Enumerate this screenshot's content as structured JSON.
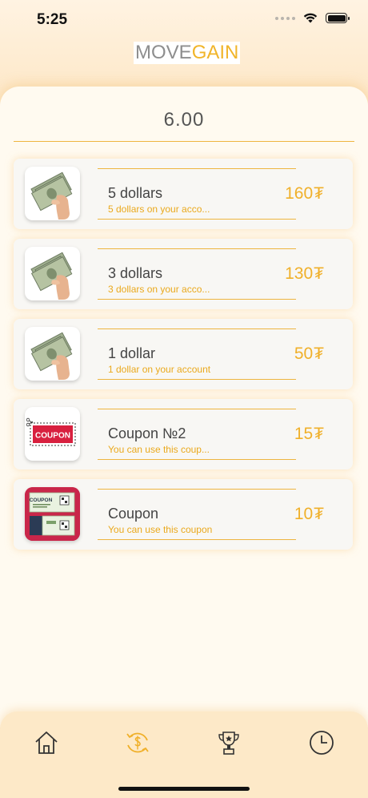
{
  "status_bar": {
    "time": "5:25"
  },
  "logo": {
    "move": "MOVE",
    "gain": "GAIN"
  },
  "balance": "6.00",
  "items": [
    {
      "title": "5 dollars",
      "desc": "5 dollars on your acco...",
      "price": "160",
      "icon": "dollar-bill-hand-icon"
    },
    {
      "title": "3 dollars",
      "desc": "3 dollars on your acco...",
      "price": "130",
      "icon": "dollar-bill-hand-icon"
    },
    {
      "title": "1 dollar",
      "desc": "1 dollar on your account",
      "price": "50",
      "icon": "dollar-bill-hand-icon"
    },
    {
      "title": "Coupon №2",
      "desc": "You can use this coup...",
      "price": "15",
      "icon": "coupon-scissors-icon",
      "thumb_text": "COUPON"
    },
    {
      "title": "Coupon",
      "desc": "You can use this coupon",
      "price": "10",
      "icon": "coupon-ticket-icon",
      "thumb_text": "COUPON"
    }
  ],
  "currency_symbol": "₮",
  "tabs": [
    {
      "icon": "home-icon"
    },
    {
      "icon": "exchange-coin-icon",
      "active": true
    },
    {
      "icon": "trophy-icon"
    },
    {
      "icon": "clock-icon"
    }
  ],
  "colors": {
    "accent": "#f0b02a",
    "background": "#fde9c8",
    "sheet": "#fffaf0"
  }
}
